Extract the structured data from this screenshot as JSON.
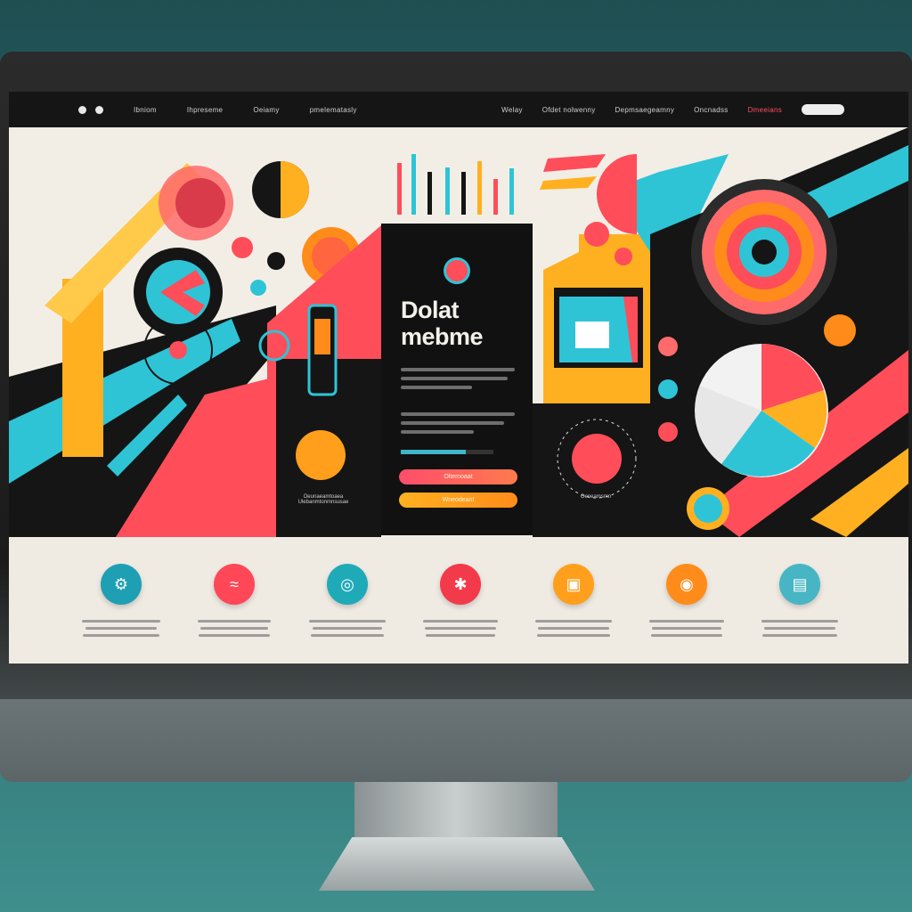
{
  "nav": {
    "links_left": [
      "Ibniom",
      "Ihpreseme",
      "Oeiamy",
      "pmelematasly"
    ],
    "links_right": [
      "Welay",
      "Ofdet nolwenny",
      "Depmsaegeamny",
      "Oncnadss",
      "Dmeeians"
    ],
    "active_index": 4
  },
  "hero": {
    "card": {
      "title_line1": "Dolat",
      "title_line2": "mebme",
      "progress_percent": 70,
      "primary_button": "Oltemoaat",
      "secondary_button": "Wneodeant"
    },
    "left_caption": "Oeunaeamtoaea Ulebanmtonmnsusae",
    "right_caption": "Oeneamsmn"
  },
  "features": {
    "items": [
      {
        "icon": "gear-icon",
        "glyph": "⚙",
        "color": "#1f9fb3"
      },
      {
        "icon": "wave-icon",
        "glyph": "≈",
        "color": "#ff4757"
      },
      {
        "icon": "user-icon",
        "glyph": "◎",
        "color": "#1faab8"
      },
      {
        "icon": "bug-icon",
        "glyph": "✱",
        "color": "#f23a4a"
      },
      {
        "icon": "document-icon",
        "glyph": "▣",
        "color": "#ff9f1c"
      },
      {
        "icon": "camera-icon",
        "glyph": "◉",
        "color": "#ff8c1a"
      },
      {
        "icon": "chart-icon",
        "glyph": "▤",
        "color": "#47b5c4"
      }
    ]
  },
  "colors": {
    "accent_coral": "#ff4d5a",
    "accent_teal": "#2ec4d6",
    "accent_orange": "#ffb020",
    "dark": "#151515",
    "paper": "#f1ede4"
  }
}
